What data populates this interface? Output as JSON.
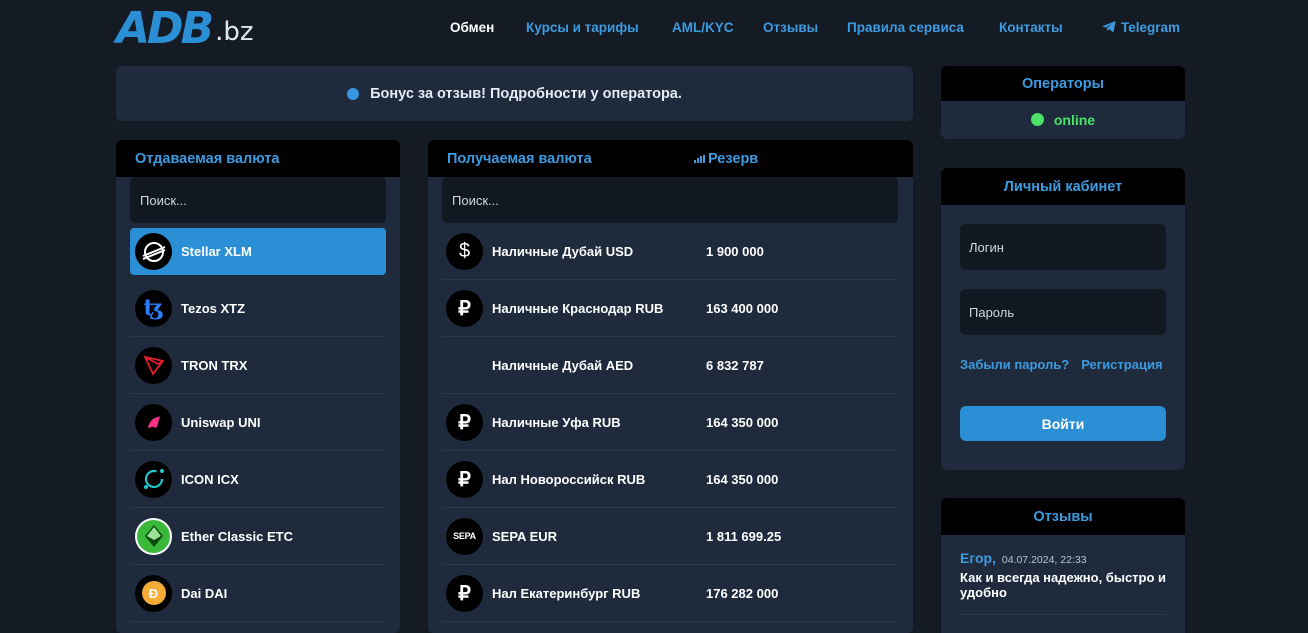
{
  "header": {
    "logo_mark": "ADB",
    "logo_tld": ".bz",
    "nav": [
      "Обмен",
      "Курсы и тарифы",
      "AML/KYC",
      "Отзывы",
      "Правила сервиса",
      "Контакты"
    ],
    "telegram": "Telegram"
  },
  "banner": {
    "text": "Бонус за отзыв! Подробности у оператора."
  },
  "give": {
    "title": "Отдаваемая валюта",
    "search_placeholder": "Поиск...",
    "items": [
      "Stellar XLM",
      "Tezos XTZ",
      "TRON TRX",
      "Uniswap UNI",
      "ICON ICX",
      "Ether Classic ETC",
      "Dai DAI"
    ]
  },
  "get": {
    "title": "Получаемая валюта",
    "reserve_title": "Резерв",
    "search_placeholder": "Поиск...",
    "items": [
      {
        "name": "Наличные Дубай USD",
        "reserve": "1 900 000",
        "icon": "$"
      },
      {
        "name": "Наличные Краснодар RUB",
        "reserve": "163 400 000",
        "icon": "₽"
      },
      {
        "name": "Наличные Дубай AED",
        "reserve": "6 832 787",
        "icon": ""
      },
      {
        "name": "Наличные Уфа RUB",
        "reserve": "164 350 000",
        "icon": "₽"
      },
      {
        "name": "Нал Новороссийск RUB",
        "reserve": "164 350 000",
        "icon": "₽"
      },
      {
        "name": "SEPA EUR",
        "reserve": "1 811 699.25",
        "icon": "SEPA"
      },
      {
        "name": "Нал Екатеринбург RUB",
        "reserve": "176 282 000",
        "icon": "₽"
      }
    ]
  },
  "operators": {
    "title": "Операторы",
    "status": "online"
  },
  "cabinet": {
    "title": "Личный кабинет",
    "login_placeholder": "Логин",
    "password_placeholder": "Пароль",
    "forgot": "Забыли пароль?",
    "register": "Регистрация",
    "submit": "Войти"
  },
  "reviews": {
    "title": "Отзывы",
    "items": [
      {
        "author": "Егор,",
        "date": "04.07.2024, 22:33",
        "text": "Как и всегда надежно, быстро и удобно"
      }
    ]
  },
  "colors": {
    "accent": "#2a8fd4",
    "online": "#4ce36a",
    "background": "#151b25",
    "panel": "#1f2b3c"
  }
}
